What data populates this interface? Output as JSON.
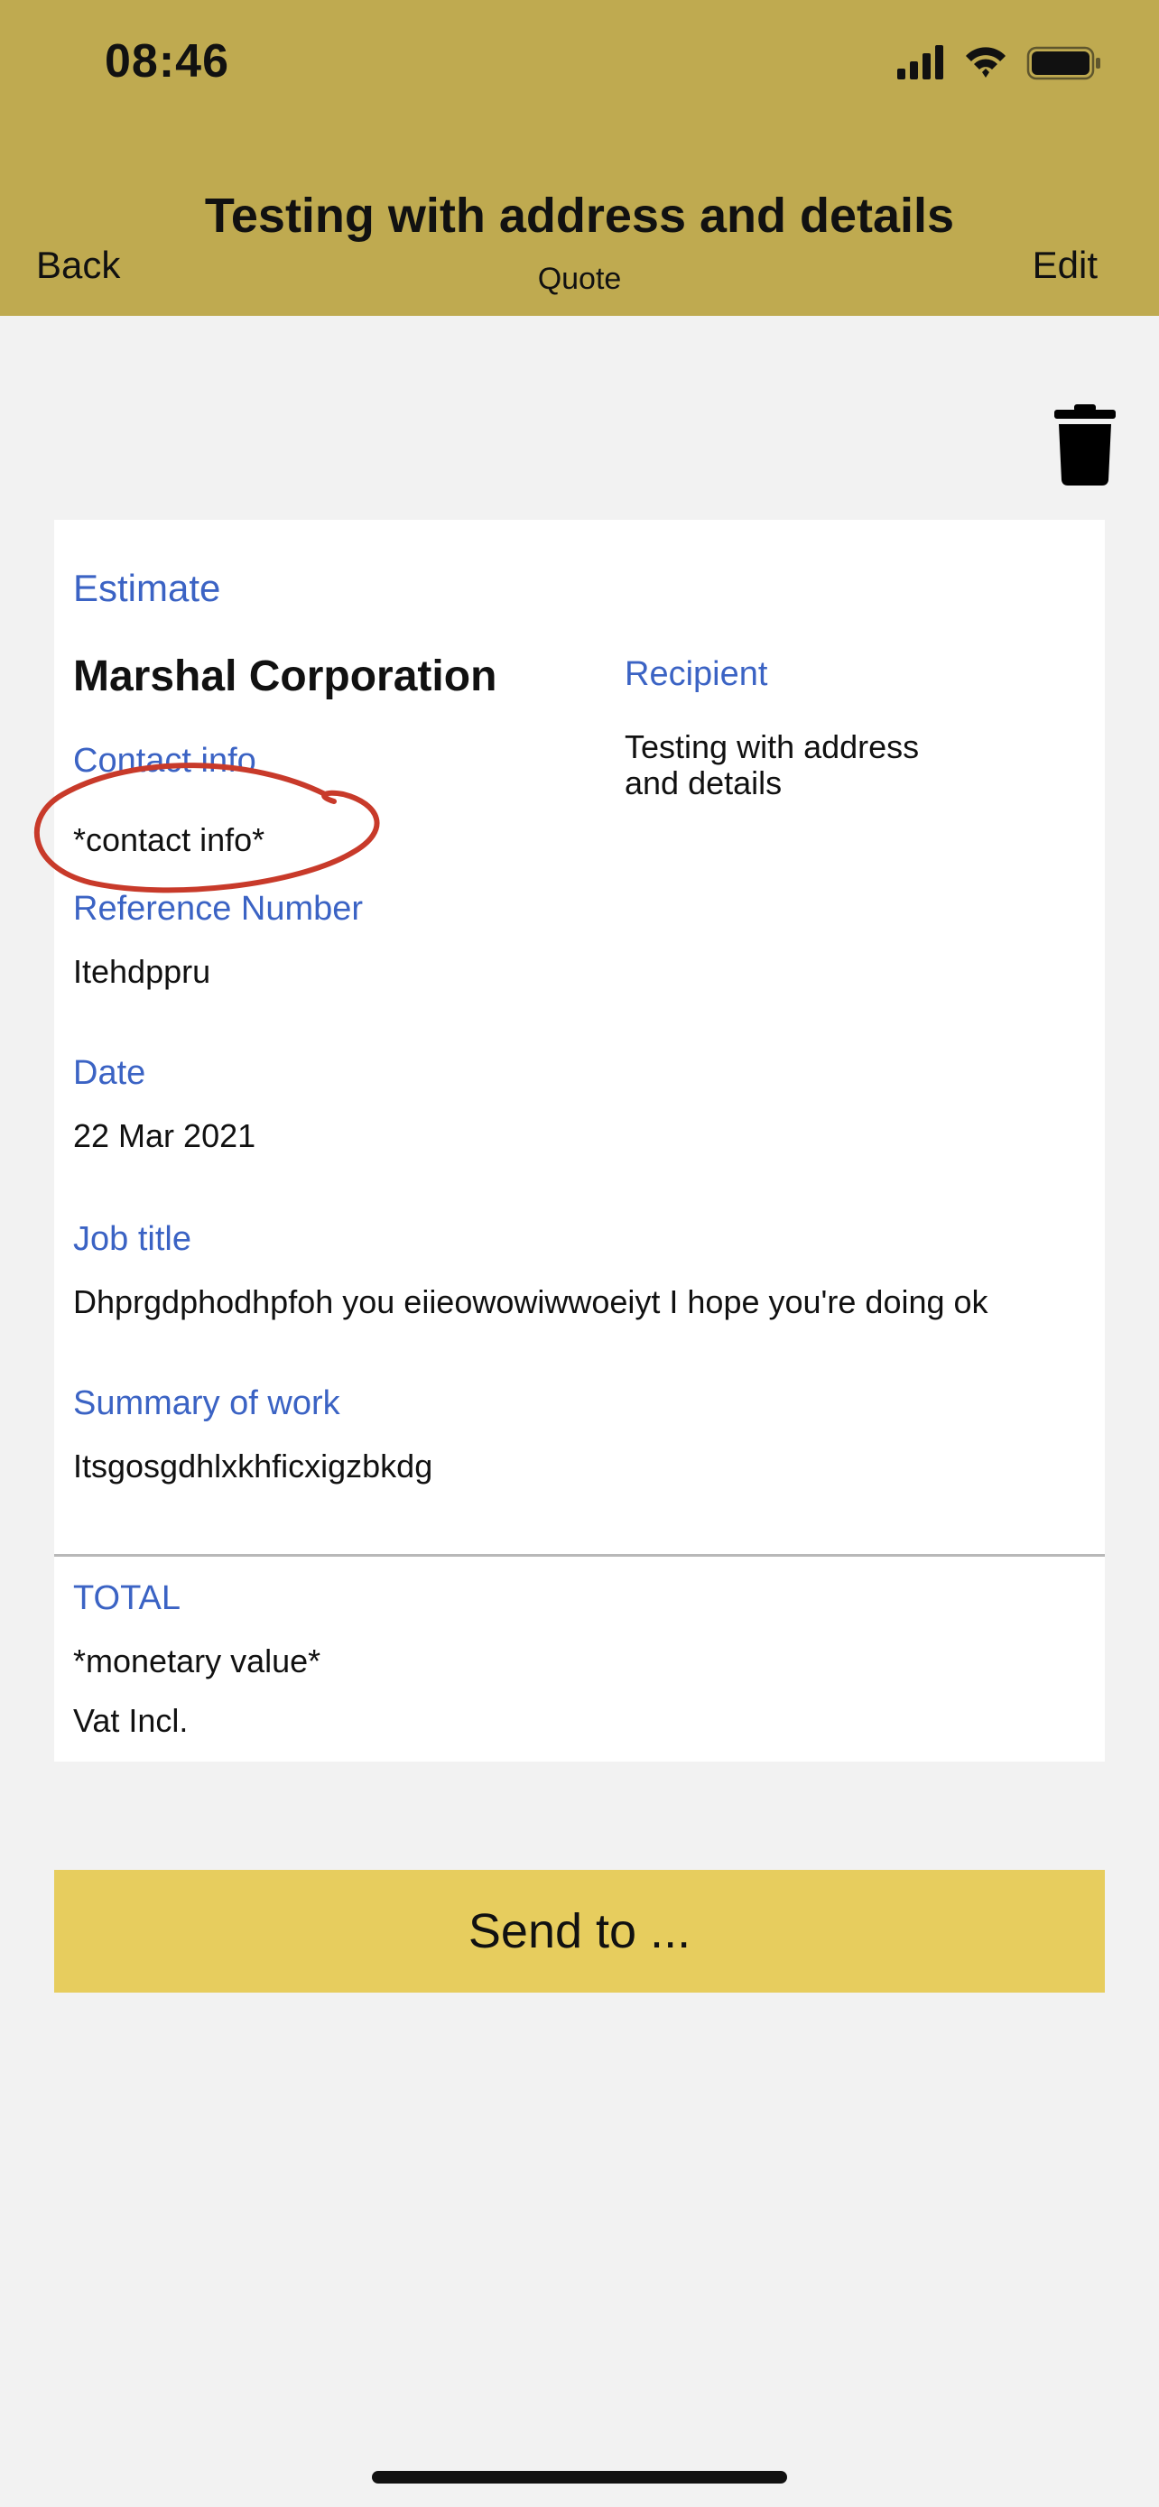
{
  "status_bar": {
    "time": "08:46",
    "icons": [
      "signal-icon",
      "wifi-icon",
      "battery-icon"
    ]
  },
  "nav": {
    "back_label": "Back",
    "title": "Testing with address and details",
    "subtitle": "Quote",
    "edit_label": "Edit"
  },
  "card": {
    "heading": "Estimate",
    "company": "Marshal Corporation",
    "contact_label": "Contact info",
    "contact_value": "*contact info*",
    "recipient_label": "Recipient",
    "recipient_value_line1": "Testing with address",
    "recipient_value_line2": "and details",
    "reference_label": "Reference Number",
    "reference_value": "Itehdppru",
    "date_label": "Date",
    "date_value": "22 Mar 2021",
    "job_title_label": "Job title",
    "job_title_value": "Dhprgdphodhpfoh you eiieowowiwwoeiyt I hope you're doing ok",
    "summary_label": "Summary of work",
    "summary_value": "Itsgosgdhlxkhficxigzbkdg",
    "total_label": "TOTAL",
    "total_value": "*monetary value*",
    "vat_label": "Vat Incl."
  },
  "actions": {
    "send_label": "Send to ..."
  },
  "colors": {
    "header": "#bfaa50",
    "label_blue": "#3b63c4",
    "send_button": "#e7cd5e",
    "annotation_red": "#c83a2a",
    "background": "#f2f2f2"
  }
}
